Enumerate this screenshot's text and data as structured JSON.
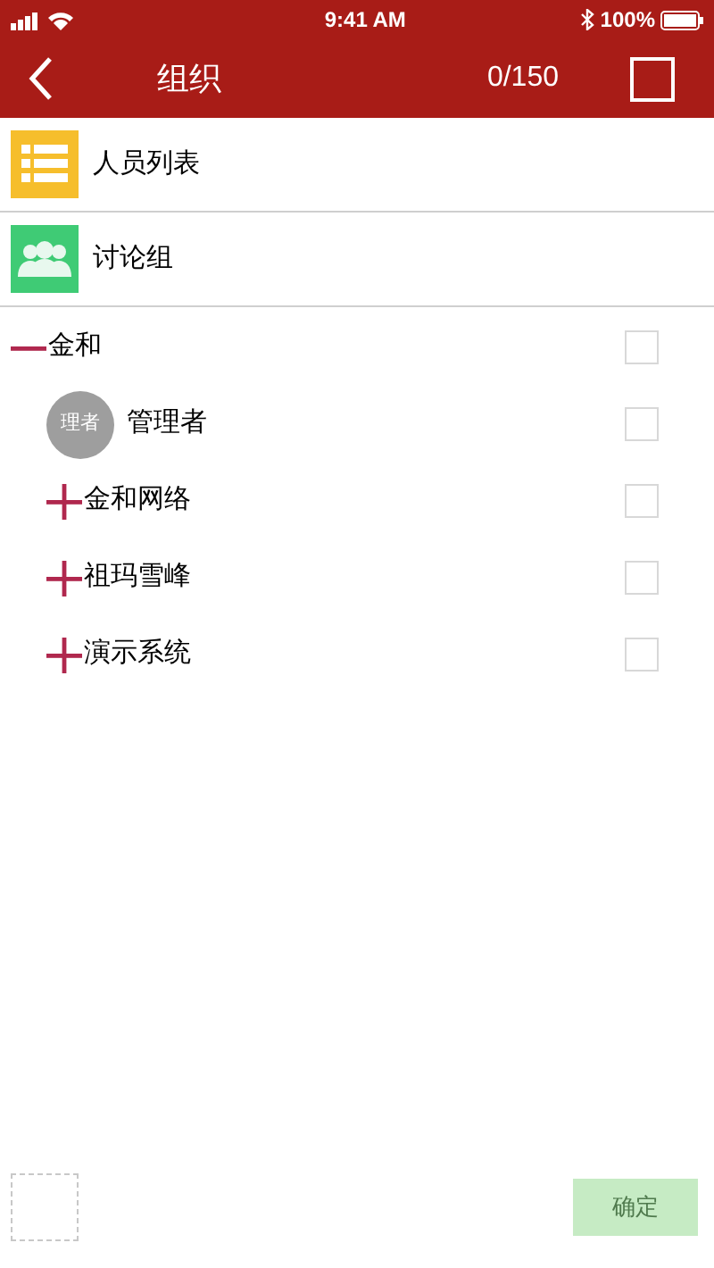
{
  "status_bar": {
    "time": "9:41 AM",
    "battery": "100%"
  },
  "header": {
    "title": "组织",
    "count": "0/150",
    "select_all": {
      "checked": false
    }
  },
  "entries": [
    {
      "label": "人员列表",
      "kind": "list"
    },
    {
      "label": "讨论组",
      "kind": "group"
    }
  ],
  "tree": [
    {
      "label": "金和",
      "kind": "org",
      "expanded": true,
      "checked": false,
      "children": [
        {
          "label": "管理者",
          "kind": "person",
          "avatar": "理者",
          "checked": false
        },
        {
          "label": "金和网络",
          "kind": "org",
          "expanded": false,
          "checked": false
        },
        {
          "label": "祖玛雪峰",
          "kind": "org",
          "expanded": false,
          "checked": false
        },
        {
          "label": "演示系统",
          "kind": "org",
          "expanded": false,
          "checked": false
        }
      ]
    }
  ],
  "footer": {
    "confirm": {
      "label": "确定",
      "disabled": true
    }
  }
}
